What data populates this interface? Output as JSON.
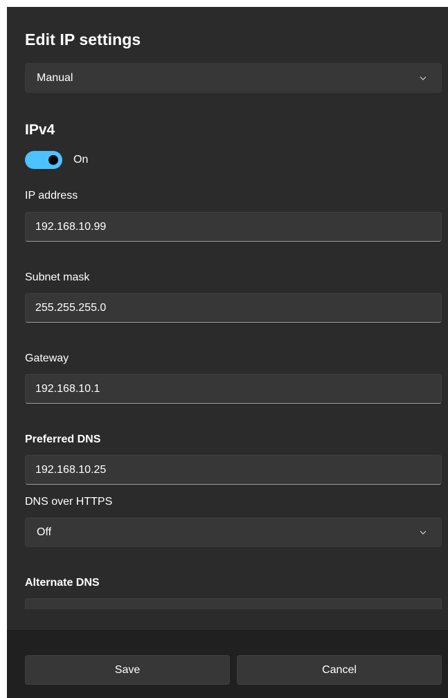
{
  "dialog": {
    "title": "Edit IP settings",
    "mode_dropdown": {
      "value": "Manual",
      "icon": "chevron-down-icon"
    }
  },
  "ipv4": {
    "heading": "IPv4",
    "toggle": {
      "state": "On",
      "on": true,
      "accent": "#4cc2ff"
    },
    "ip_address": {
      "label": "IP address",
      "value": "192.168.10.99"
    },
    "subnet_mask": {
      "label": "Subnet mask",
      "value": "255.255.255.0"
    },
    "gateway": {
      "label": "Gateway",
      "value": "192.168.10.1"
    },
    "preferred_dns": {
      "label": "Preferred DNS",
      "value": "192.168.10.25"
    },
    "dns_over_https": {
      "label": "DNS over HTTPS",
      "value": "Off",
      "icon": "chevron-down-icon"
    },
    "alternate_dns": {
      "label": "Alternate DNS",
      "value": ""
    }
  },
  "footer": {
    "save_label": "Save",
    "cancel_label": "Cancel"
  },
  "colors": {
    "background": "#2b2b2b",
    "control": "#373737",
    "footer": "#202020",
    "text": "#ffffff"
  }
}
